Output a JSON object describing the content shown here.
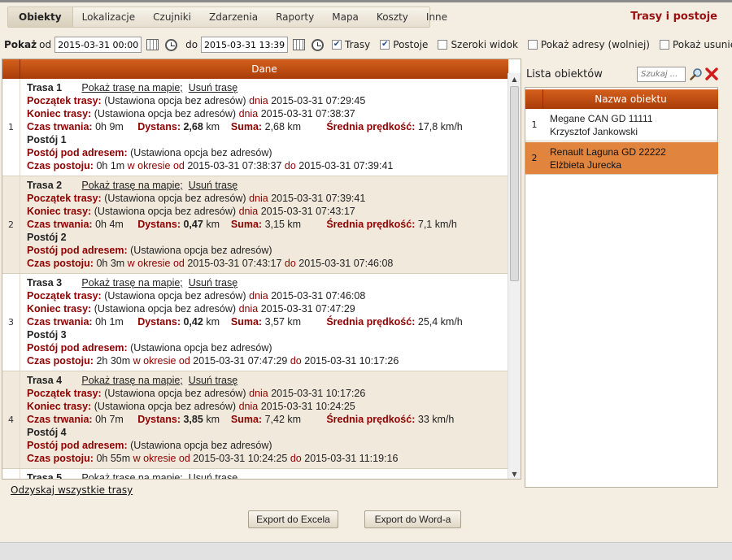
{
  "nav": {
    "items": [
      "Obiekty",
      "Lokalizacje",
      "Czujniki",
      "Zdarzenia",
      "Raporty",
      "Mapa",
      "Koszty",
      "Inne"
    ],
    "active": "Obiekty"
  },
  "page_title": "Trasy i postoje",
  "filter": {
    "show_label": "Pokaż",
    "from_label": "od",
    "from_value": "2015-03-31 00:00",
    "to_label": "do",
    "to_value": "2015-03-31 13:39",
    "checkboxes": [
      {
        "label": "Trasy",
        "checked": true
      },
      {
        "label": "Postoje",
        "checked": true
      },
      {
        "label": "Szeroki widok",
        "checked": false
      },
      {
        "label": "Pokaż adresy (wolniej)",
        "checked": false
      },
      {
        "label": "Pokaż usunięte",
        "checked": false
      }
    ]
  },
  "table": {
    "header": "Dane",
    "labels": {
      "show_on_map": "Pokaż trasę na mapie;",
      "delete": "Usuń trasę",
      "start": "Początek trasy:",
      "end": "Koniec trasy:",
      "duration": "Czas trwania:",
      "distance": "Dystans:",
      "sum": "Suma:",
      "avg_speed": "Średnia prędkość:",
      "stop_address": "Postój pod adresem:",
      "stop_time": "Czas postoju:",
      "no_address": "(Ustawiona opcja bez adresów)",
      "on_day": "dnia",
      "in_period_from": "w okresie od",
      "to": "do"
    },
    "rows": [
      {
        "num": "1",
        "route": "Trasa 1",
        "start_date": "2015-03-31 07:29:45",
        "end_date": "2015-03-31 07:38:37",
        "duration": "0h 9m",
        "distance": "2,68",
        "distance_unit": "km",
        "sum": "2,68 km",
        "speed": "17,8 km/h",
        "stop": "Postój 1",
        "stop_duration": "0h 1m",
        "stop_from": "2015-03-31 07:38:37",
        "stop_to": "2015-03-31 07:39:41"
      },
      {
        "num": "2",
        "route": "Trasa 2",
        "start_date": "2015-03-31 07:39:41",
        "end_date": "2015-03-31 07:43:17",
        "duration": "0h 4m",
        "distance": "0,47",
        "distance_unit": "km",
        "sum": "3,15 km",
        "speed": "7,1 km/h",
        "stop": "Postój 2",
        "stop_duration": "0h 3m",
        "stop_from": "2015-03-31 07:43:17",
        "stop_to": "2015-03-31 07:46:08"
      },
      {
        "num": "3",
        "route": "Trasa 3",
        "start_date": "2015-03-31 07:46:08",
        "end_date": "2015-03-31 07:47:29",
        "duration": "0h 1m",
        "distance": "0,42",
        "distance_unit": "km",
        "sum": "3,57 km",
        "speed": "25,4 km/h",
        "stop": "Postój 3",
        "stop_duration": "2h 30m",
        "stop_from": "2015-03-31 07:47:29",
        "stop_to": "2015-03-31 10:17:26"
      },
      {
        "num": "4",
        "route": "Trasa 4",
        "start_date": "2015-03-31 10:17:26",
        "end_date": "2015-03-31 10:24:25",
        "duration": "0h 7m",
        "distance": "3,85",
        "distance_unit": "km",
        "sum": "7,42 km",
        "speed": "33 km/h",
        "stop": "Postój 4",
        "stop_duration": "0h 55m",
        "stop_from": "2015-03-31 10:24:25",
        "stop_to": "2015-03-31 11:19:16"
      },
      {
        "num": "",
        "route": "Trasa 5"
      }
    ]
  },
  "recover_all": "Odzyskaj wszystkie trasy",
  "side": {
    "title": "Lista obiektów",
    "search_placeholder": "Szukaj ...",
    "header": "Nazwa obiektu",
    "objects": [
      {
        "num": "1",
        "name": "Megane CAN GD 11111",
        "driver": "Krzysztof Jankowski",
        "selected": false
      },
      {
        "num": "2",
        "name": "Renault Laguna GD 22222",
        "driver": "Elżbieta Jurecka",
        "selected": true
      }
    ]
  },
  "buttons": {
    "export_excel": "Export do Excela",
    "export_word": "Export do Word-a"
  },
  "colors": {
    "header": "#c04a10",
    "selected_row": "#e1843e",
    "label_red": "#8f0000",
    "title_red": "#9b1010"
  }
}
